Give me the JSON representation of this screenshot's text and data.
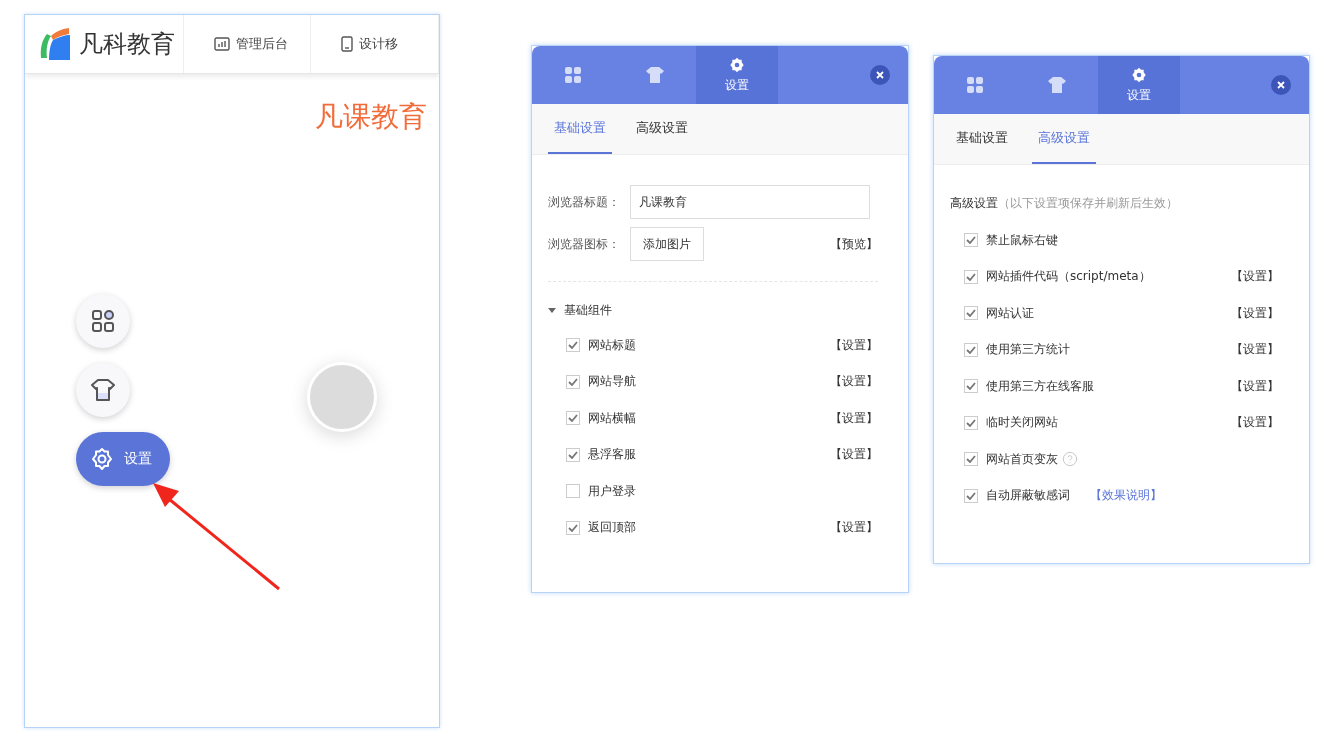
{
  "preview": {
    "logo": "凡科教育",
    "nav": [
      {
        "kind": "chart",
        "label": "管理后台"
      },
      {
        "kind": "phone",
        "label": "设计移"
      }
    ],
    "site_title": "凡课教育",
    "float_buttons": [
      {
        "kind": "grid",
        "selected": false
      },
      {
        "kind": "shirt",
        "selected": false
      },
      {
        "kind": "gear",
        "label": "设置",
        "selected": true
      }
    ]
  },
  "panels": [
    {
      "kind": "basic",
      "top_tabs": [
        {
          "kind": "grid",
          "selected": false
        },
        {
          "kind": "shirt",
          "selected": false
        },
        {
          "kind": "gear",
          "label": "设置",
          "selected": true
        }
      ],
      "sub_tabs": [
        {
          "label": "基础设置",
          "selected": true
        },
        {
          "label": "高级设置",
          "selected": false
        }
      ],
      "title_field": {
        "label": "浏览器标题：",
        "value": "凡课教育"
      },
      "icon_field": {
        "label": "浏览器图标：",
        "button": "添加图片",
        "link": "【预览】"
      },
      "section": {
        "label": "基础组件",
        "expanded": true
      },
      "items": [
        {
          "label": "网站标题",
          "checked": true,
          "action": "【设置】"
        },
        {
          "label": "网站导航",
          "checked": true,
          "action": "【设置】"
        },
        {
          "label": "网站横幅",
          "checked": true,
          "action": "【设置】"
        },
        {
          "label": "悬浮客服",
          "checked": true,
          "action": "【设置】"
        },
        {
          "label": "用户登录",
          "checked": false
        },
        {
          "label": "返回顶部",
          "checked": true,
          "action": "【设置】"
        }
      ]
    },
    {
      "kind": "advanced",
      "top_tabs": [
        {
          "kind": "grid",
          "selected": false
        },
        {
          "kind": "shirt",
          "selected": false
        },
        {
          "kind": "gear",
          "label": "设置",
          "selected": true
        }
      ],
      "sub_tabs": [
        {
          "label": "基础设置",
          "selected": false
        },
        {
          "label": "高级设置",
          "selected": true
        }
      ],
      "heading": "高级设置",
      "note": "（以下设置项保存并刷新后生效）",
      "items": [
        {
          "label": "禁止鼠标右键",
          "checked": true
        },
        {
          "label": "网站插件代码（script/meta）",
          "checked": true,
          "action": "【设置】"
        },
        {
          "label": "网站认证",
          "checked": true,
          "action": "【设置】"
        },
        {
          "label": "使用第三方统计",
          "checked": true,
          "action": "【设置】"
        },
        {
          "label": "使用第三方在线客服",
          "checked": true,
          "action": "【设置】"
        },
        {
          "label": "临时关闭网站",
          "checked": true,
          "action": "【设置】"
        },
        {
          "label": "网站首页变灰",
          "checked": true,
          "help": true
        },
        {
          "label": "自动屏蔽敏感词",
          "checked": true,
          "link": "【效果说明】"
        }
      ]
    }
  ]
}
